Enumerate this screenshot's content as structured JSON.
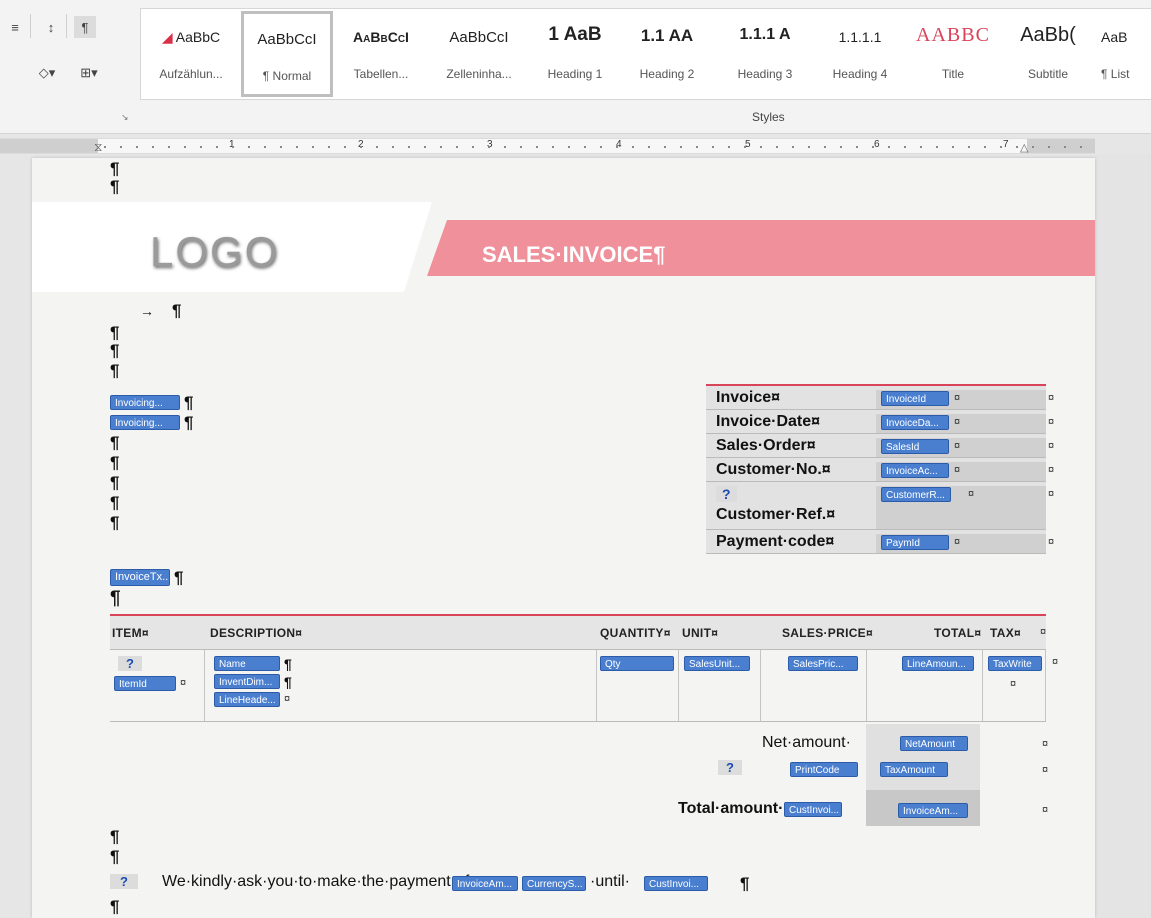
{
  "ribbon": {
    "styles": [
      {
        "sample": "AaBbC",
        "label": "Aufzählun..."
      },
      {
        "sample": "AaBbCcI",
        "label": "¶ Normal"
      },
      {
        "sample": "AaBbCcI",
        "label": "Tabellen..."
      },
      {
        "sample": "AaBbCcI",
        "label": "Zelleninha..."
      },
      {
        "sample": "1  AaB",
        "label": "Heading 1"
      },
      {
        "sample": "1.1  AA",
        "label": "Heading 2"
      },
      {
        "sample": "1.1.1  A",
        "label": "Heading 3"
      },
      {
        "sample": "1.1.1.1",
        "label": "Heading 4"
      },
      {
        "sample": "AABBC",
        "label": "Title"
      },
      {
        "sample": "AaBb(",
        "label": "Subtitle"
      },
      {
        "sample": "AaB",
        "label": "¶ List"
      }
    ],
    "group_label": "Styles",
    "dialog_launcher": "↘"
  },
  "ruler": {
    "numbers": [
      "1",
      "2",
      "3",
      "4",
      "5",
      "6",
      "7"
    ]
  },
  "page": {
    "logo": "LOGO",
    "title": "SALES·INVOICE¶",
    "pilcrow": "¶",
    "arrow": "→",
    "invoicing_fields": [
      "Invoicing...",
      "Invoicing..."
    ],
    "invoice_tx_field": "InvoiceTx...",
    "info_rows": [
      {
        "label": "Invoice¤",
        "field": "InvoiceId"
      },
      {
        "label": "Invoice·Date¤",
        "field": "InvoiceDa..."
      },
      {
        "label": "Sales·Order¤",
        "field": "SalesId"
      },
      {
        "label": "Customer·No.¤",
        "field": "InvoiceAc..."
      },
      {
        "label": "Customer·Ref.¤",
        "field": "CustomerR..."
      },
      {
        "label": "Payment·code¤",
        "field": "PaymId"
      }
    ],
    "cell_mark": "¤",
    "items_headers": [
      "ITEM¤",
      "DESCRIPTION¤",
      "QUANTITY¤",
      "UNIT¤",
      "SALES·PRICE¤",
      "TOTAL¤",
      "TAX¤"
    ],
    "items_fields": {
      "item": "ItemId",
      "name": "Name",
      "invent_dim": "InventDim...",
      "line_header": "LineHeade...",
      "qty": "Qty",
      "sales_unit": "SalesUnit...",
      "sales_price": "SalesPric...",
      "line_amount": "LineAmoun...",
      "tax_write": "TaxWrite"
    },
    "totals": {
      "net_label": "Net·amount·",
      "net_field": "NetAmount",
      "print_code_field": "PrintCode",
      "tax_amount_field": "TaxAmount",
      "total_label": "Total·amount·",
      "total_cust_field": "CustInvoi...",
      "total_field": "InvoiceAm..."
    },
    "payment_sentence": {
      "prefix": "We·kindly·ask·you·to·make·the·payment·of·",
      "field1": "InvoiceAm...",
      "field2": "CurrencyS...",
      "middle": "·until·",
      "field3": "CustInvoi...",
      "end": "¶"
    },
    "placeholder_q": "?"
  }
}
